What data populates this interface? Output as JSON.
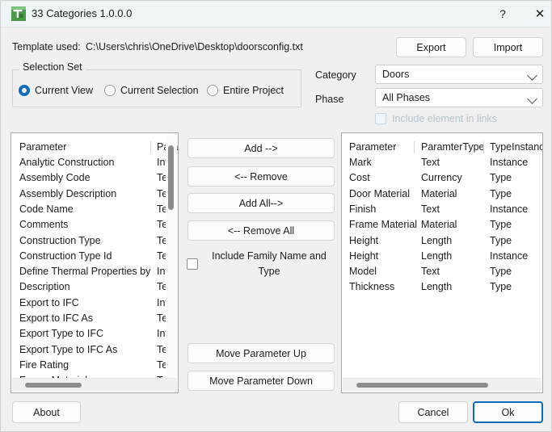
{
  "window": {
    "title": "33 Categories 1.0.0.0",
    "icon": "app-logo-icon",
    "help_glyph": "?",
    "close_glyph": "✕"
  },
  "template": {
    "label": "Template used:",
    "path": "C:\\Users\\chris\\OneDrive\\Desktop\\doorsconfig.txt",
    "export_label": "Export",
    "import_label": "Import"
  },
  "selection_set": {
    "group_title": "Selection Set",
    "options": [
      {
        "label": "Current View",
        "selected": true
      },
      {
        "label": "Current Selection",
        "selected": false
      },
      {
        "label": "Entire Project",
        "selected": false
      }
    ]
  },
  "filters": {
    "category_label": "Category",
    "category_value": "Doors",
    "phase_label": "Phase",
    "phase_value": "All Phases",
    "include_links_label": "Include element in links",
    "include_links_checked": false,
    "include_links_disabled": true
  },
  "available_list": {
    "headers": [
      "Parameter",
      "Para"
    ],
    "rows": [
      [
        "Analytic Construction",
        "Inva"
      ],
      [
        "Assembly Code",
        "Text"
      ],
      [
        "Assembly Description",
        "Text"
      ],
      [
        "Code Name",
        "Text"
      ],
      [
        "Comments",
        "Text"
      ],
      [
        "Construction Type",
        "Text"
      ],
      [
        "Construction Type Id",
        "Text"
      ],
      [
        "Define Thermal Properties by",
        "Inva"
      ],
      [
        "Description",
        "Text"
      ],
      [
        "Export to IFC",
        "Inva"
      ],
      [
        "Export to IFC As",
        "Text"
      ],
      [
        "Export Type to IFC",
        "Inva"
      ],
      [
        "Export Type to IFC As",
        "Text"
      ],
      [
        "Fire Rating",
        "Text"
      ],
      [
        "Frame Material",
        "Text"
      ]
    ]
  },
  "selected_list": {
    "headers": [
      "Parameter",
      "ParamterType",
      "TypeInstance"
    ],
    "rows": [
      [
        "Mark",
        "Text",
        "Instance"
      ],
      [
        "Cost",
        "Currency",
        "Type"
      ],
      [
        "Door Material",
        "Material",
        "Type"
      ],
      [
        "Finish",
        "Text",
        "Instance"
      ],
      [
        "Frame Material",
        "Material",
        "Type"
      ],
      [
        "Height",
        "Length",
        "Type"
      ],
      [
        "Height",
        "Length",
        "Instance"
      ],
      [
        "Model",
        "Text",
        "Type"
      ],
      [
        "Thickness",
        "Length",
        "Type"
      ]
    ]
  },
  "transfer": {
    "add": "Add -->",
    "remove": "<-- Remove",
    "add_all": "Add All-->",
    "remove_all": "<-- Remove All",
    "include_family_label": "Include  Family  Name and Type",
    "include_family_checked": false,
    "move_up": "Move Parameter Up",
    "move_down": "Move Parameter Down"
  },
  "footer": {
    "about": "About",
    "cancel": "Cancel",
    "ok": "Ok"
  },
  "colors": {
    "accent": "#0f6cbd",
    "titlebar": "#eff5f7",
    "body": "#f0f0f0",
    "disabled_text": "#b4c3cc"
  }
}
